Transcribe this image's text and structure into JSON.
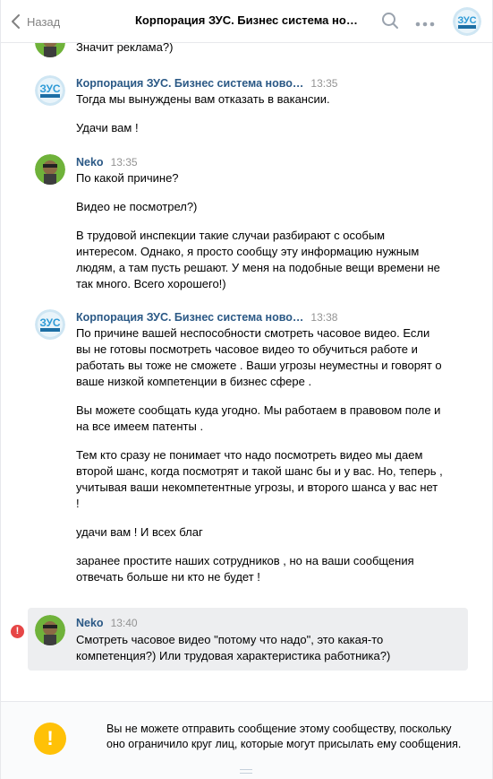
{
  "header": {
    "back_label": "Назад",
    "title": "Корпорация ЗУС. Бизнес система но…"
  },
  "messages": [
    {
      "author": "",
      "time": "",
      "paragraphs": [
        "Значит реклама?)"
      ]
    },
    {
      "author": "Корпорация ЗУС. Бизнес система ново…",
      "time": "13:35",
      "paragraphs": [
        "Тогда мы вынуждены вам отказать в вакансии.",
        "Удачи вам !"
      ]
    },
    {
      "author": "Neko",
      "time": "13:35",
      "paragraphs": [
        "По какой причине?",
        "Видео не посмотрел?)",
        "В трудовой инспекции такие случаи разбирают с особым интересом. Однако, я просто сообщу эту информацию нужным людям, а там пусть решают. У меня на подобные вещи времени не так много. Всего хорошего!)"
      ]
    },
    {
      "author": "Корпорация ЗУС. Бизнес система ново…",
      "time": "13:38",
      "paragraphs": [
        "По причине вашей неспособности смотреть часовое видео. Если вы не готовы посмотреть часовое видео то обучиться работе и работать вы тоже не сможете . Ваши угрозы неуместны и говорят о ваше низкой компетенции в бизнес сфере .",
        "Вы можете сообщать куда угодно. Мы работаем в правовом поле и на все имеем патенты .",
        "Тем кто сразу не понимает что надо посмотреть видео мы даем второй шанс, когда посмотрят и такой шанс бы и у вас. Но, теперь , учитывая ваши некомпетентные угрозы, и второго шанса у вас нет !",
        "удачи вам ! И всех благ",
        "заранее простите наших сотрудников , но на ваши сообщения отвечать больше ни кто не будет !"
      ]
    },
    {
      "author": "Neko",
      "time": "13:40",
      "paragraphs": [
        "Смотреть часовое видео \"потому что надо\", это какая-то компетенция?) Или трудовая характеристика работника?)"
      ]
    }
  ],
  "footer": {
    "notice": "Вы не можете отправить сообщение этому сообществу, поскольку оно ограничило круг лиц, которые могут присылать ему сообщения."
  },
  "avatars": {
    "company_label": "ЗУС",
    "company_sub": "КОРПОРАЦИЯ"
  },
  "colors": {
    "link": "#2a5885",
    "time": "#939393",
    "error": "#e64646",
    "warning": "#ffc107"
  }
}
